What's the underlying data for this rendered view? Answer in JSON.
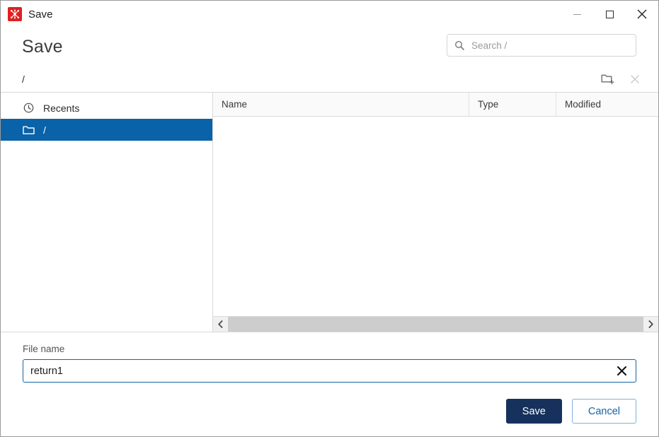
{
  "window": {
    "title": "Save",
    "app_icon": "network-graph-icon",
    "controls": {
      "minimize": "minimize-icon",
      "maximize": "maximize-icon",
      "close": "close-icon"
    }
  },
  "header": {
    "page_title": "Save",
    "search": {
      "icon": "search-icon",
      "placeholder": "Search /",
      "value": ""
    }
  },
  "breadcrumb": {
    "path": "/",
    "tools": [
      {
        "name": "new-folder-icon",
        "label": "New folder",
        "enabled": true
      },
      {
        "name": "delete-icon",
        "label": "Delete",
        "enabled": false
      }
    ]
  },
  "sidebar": {
    "items": [
      {
        "label": "Recents",
        "icon": "clock-icon",
        "selected": false
      },
      {
        "label": "/",
        "icon": "folder-icon",
        "selected": true
      }
    ]
  },
  "file_list": {
    "columns": [
      {
        "label": "Name"
      },
      {
        "label": "Type"
      },
      {
        "label": "Modified"
      }
    ],
    "rows": [],
    "scrollbar": {
      "left_arrow": "chevron-left-icon",
      "right_arrow": "chevron-right-icon"
    }
  },
  "footer": {
    "file_name_label": "File name",
    "file_name_value": "return1",
    "file_name_placeholder": "",
    "clear_icon": "clear-x-icon",
    "save_label": "Save",
    "cancel_label": "Cancel"
  },
  "colors": {
    "accent_blue": "#0a62a8",
    "primary_button": "#16325c",
    "secondary_text": "#1464a5",
    "app_icon_red": "#e02020",
    "field_border_focus": "#1464a5"
  }
}
